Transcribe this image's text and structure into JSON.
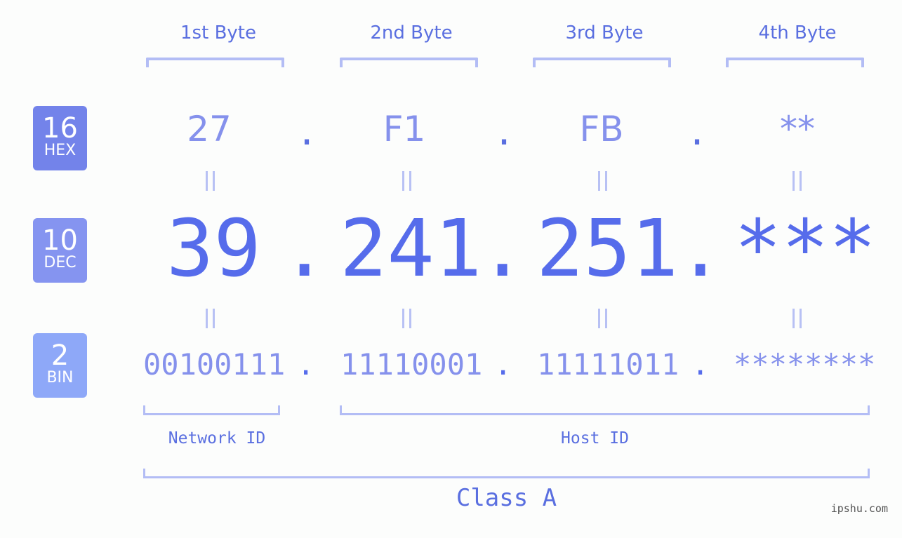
{
  "ip_masked": "39.241.251.***",
  "byte_headers": [
    "1st Byte",
    "2nd Byte",
    "3rd Byte",
    "4th Byte"
  ],
  "badges": {
    "hex": {
      "num": "16",
      "label": "HEX",
      "color": "#7383ea"
    },
    "dec": {
      "num": "10",
      "label": "DEC",
      "color": "#8594f0"
    },
    "bin": {
      "num": "2",
      "label": "BIN",
      "color": "#8ea8f8"
    }
  },
  "hex": [
    "27",
    "F1",
    "FB",
    "**"
  ],
  "dec": [
    "39",
    "241",
    "251",
    "***"
  ],
  "bin": [
    "00100111",
    "11110001",
    "11111011",
    "********"
  ],
  "separator": ".",
  "equals": "=",
  "network_id_label": "Network ID",
  "host_id_label": "Host ID",
  "class_label": "Class A",
  "watermark": "ipshu.com",
  "colors": {
    "primary": "#566ceb",
    "light": "#8591ec",
    "bracket": "#b3bdf5"
  }
}
